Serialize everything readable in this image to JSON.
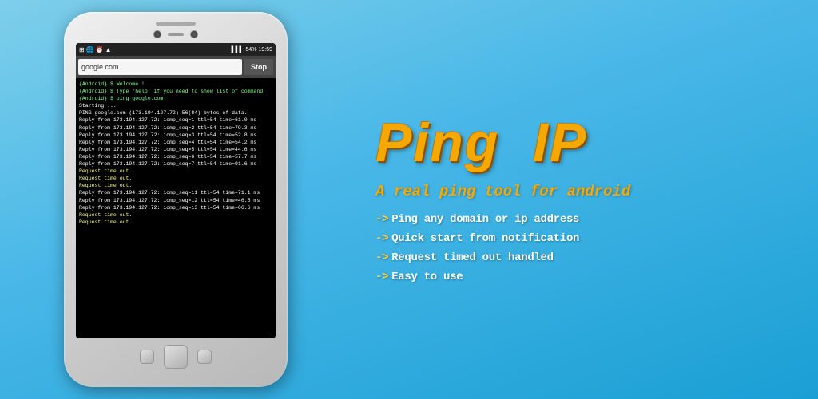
{
  "background": {
    "gradient_start": "#7ecfea",
    "gradient_end": "#1a9fd4"
  },
  "phone": {
    "status_bar": {
      "left_icons": [
        "nav-icon",
        "browser-icon",
        "alarm-icon",
        "wifi-icon"
      ],
      "right_info": "54%  19:59"
    },
    "url_input": {
      "value": "google.com",
      "placeholder": "google.com"
    },
    "stop_button_label": "Stop",
    "terminal_lines": [
      "{Android} $ Welcome !",
      "{Android} $ Type 'help' if you need to show list of command",
      "{Android} $ ping google.com",
      "Starting ...",
      "PING google.com (173.194.127.72) 56(84) bytes of data.",
      "Reply from 173.194.127.72: icmp_seq=1 ttl=54 time=61.0 ms",
      "Reply from 173.194.127.72: icmp_seq=2 ttl=54 time=79.3 ms",
      "Reply from 173.194.127.72: icmp_seq=3 ttl=54 time=52.8 ms",
      "Reply from 173.194.127.72: icmp_seq=4 ttl=54 time=54.2 ms",
      "Reply from 173.194.127.72: icmp_seq=5 ttl=54 time=44.6 ms",
      "Reply from 173.194.127.72: icmp_seq=6 ttl=54 time=57.7 ms",
      "Reply from 173.194.127.72: icmp_seq=7 ttl=54 time=91.6 ms",
      "Request time out.",
      "Request time out.",
      "Request time out.",
      "Reply from 173.194.127.72: icmp_seq=11 ttl=54 time=71.1 ms",
      "Reply from 173.194.127.72: icmp_seq=12 ttl=54 time=46.5 ms",
      "Reply from 173.194.127.72: icmp_seq=13 ttl=54 time=66.6 ms",
      "Request time out.",
      "Request time out."
    ]
  },
  "app": {
    "title_part1": "Ping",
    "title_part2": "IP",
    "subtitle": "A real ping tool for android",
    "features": [
      "Ping any domain or ip address",
      "Quick start from notification",
      "Request timed out handled",
      "Easy to use"
    ],
    "arrow_symbol": "->"
  }
}
